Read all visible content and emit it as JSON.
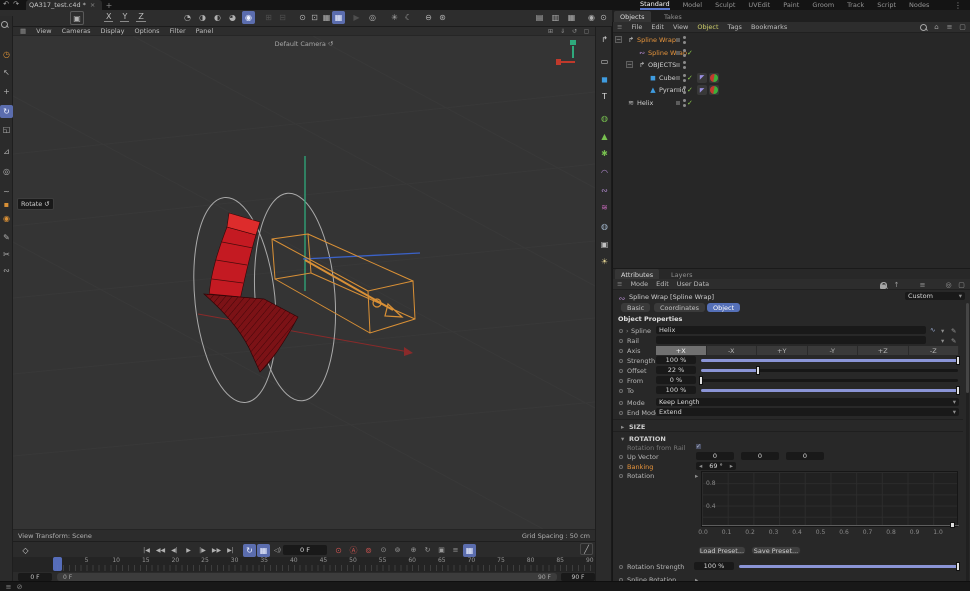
{
  "ui": {
    "drop": "▾",
    "check": "✓",
    "minus": "−",
    "plus": "+"
  },
  "window": {
    "undo_glyph": "↶",
    "redo_glyph": "↷",
    "doc_tab": "QA317_test.c4d *",
    "close_glyph": "×",
    "new_tab_glyph": "+"
  },
  "layout_tabs": {
    "items": [
      "Standard",
      "Model",
      "Sculpt",
      "UVEdit",
      "Paint",
      "Groom",
      "Track",
      "Script",
      "Nodes"
    ],
    "active": "Standard",
    "overflow_glyph": "⋮"
  },
  "toolbar": {
    "axis_locks": [
      "X",
      "Y",
      "Z"
    ],
    "box_tool_glyph": "▣",
    "icons": [
      {
        "name": "render-view",
        "glyph": "◔"
      },
      {
        "name": "render-region",
        "glyph": "◑"
      },
      {
        "name": "render-material",
        "glyph": "◐"
      },
      {
        "name": "render-picture-viewer",
        "glyph": "◕"
      },
      {
        "name": "render-settings",
        "glyph": "◉",
        "mod": "blue"
      },
      {
        "name": "disabled-tool-a",
        "glyph": "⊞",
        "mod": "dim"
      },
      {
        "name": "disabled-tool-b",
        "glyph": "⊟",
        "mod": "dim"
      },
      {
        "name": "object-axis",
        "glyph": "⊙"
      },
      {
        "name": "workplane",
        "glyph": "⊡"
      },
      {
        "name": "snap-grid",
        "glyph": "▦"
      },
      {
        "name": "quantize",
        "glyph": "▦",
        "mod": "blue"
      },
      {
        "name": "play-disabled",
        "glyph": "▶",
        "mod": "dim"
      },
      {
        "name": "target",
        "glyph": "◎"
      },
      {
        "name": "simulate",
        "glyph": "✳"
      },
      {
        "name": "field-moon",
        "glyph": "☾"
      },
      {
        "name": "remove-circle",
        "glyph": "⊖"
      },
      {
        "name": "modify-circle",
        "glyph": "⊛"
      },
      {
        "name": "layout-panel-a",
        "glyph": "▤"
      },
      {
        "name": "layout-panel-b",
        "glyph": "▥"
      },
      {
        "name": "layout-panel-c",
        "glyph": "▦"
      },
      {
        "name": "user-sphere",
        "glyph": "◉"
      },
      {
        "name": "user-dot",
        "glyph": "⊙"
      }
    ]
  },
  "left_palette": {
    "icons": [
      {
        "name": "search",
        "glyph": "mag"
      },
      {
        "name": "live-selection",
        "glyph": "◷",
        "color": "#d99036"
      },
      {
        "name": "selection-cursor",
        "glyph": "↖"
      },
      {
        "name": "move-tool",
        "glyph": "+"
      },
      {
        "name": "rotate-tool",
        "glyph": "↻",
        "active": true
      },
      {
        "name": "scale-tool",
        "glyph": "◱"
      },
      {
        "name": "axis-tool",
        "glyph": "⊿"
      },
      {
        "name": "coord-tool",
        "glyph": "◎"
      },
      {
        "name": "curve-tool",
        "glyph": "~"
      },
      {
        "name": "point-tool",
        "glyph": "▪",
        "color": "#d99036"
      },
      {
        "name": "clone-tool",
        "glyph": "◉",
        "color": "#d99036"
      },
      {
        "name": "pen-tool",
        "glyph": "✎"
      },
      {
        "name": "knife-tool",
        "glyph": "✂"
      },
      {
        "name": "spline-tool",
        "glyph": "∾"
      }
    ]
  },
  "right_palette": {
    "icons": [
      {
        "name": "spline-wrap-command",
        "glyph": "↱",
        "color": "#d0d0d0"
      },
      {
        "name": "rectangle-spline",
        "glyph": "▭",
        "color": "#d8d8d8"
      },
      {
        "name": "cube-primitive",
        "glyph": "◼",
        "color": "#3f9ce0"
      },
      {
        "name": "text-object",
        "glyph": "T",
        "color": "#d8d8d8"
      },
      {
        "name": "generator-subdivide",
        "glyph": "◍",
        "color": "#77c04f"
      },
      {
        "name": "generator-array",
        "glyph": "▲",
        "color": "#77c04f"
      },
      {
        "name": "generator-boole",
        "glyph": "✱",
        "color": "#77c04f"
      },
      {
        "name": "deformer-bend",
        "glyph": "◠",
        "color": "#b78fd6"
      },
      {
        "name": "deformer-spline-wrap",
        "glyph": "∾",
        "color": "#b78fd6"
      },
      {
        "name": "deformer-other",
        "glyph": "≋",
        "color": "#c468b8"
      },
      {
        "name": "environment",
        "glyph": "◍",
        "color": "#9fb3c8"
      },
      {
        "name": "camera",
        "glyph": "▣",
        "color": "#c0c0c0"
      },
      {
        "name": "light",
        "glyph": "☀",
        "color": "#e0d090"
      }
    ]
  },
  "viewport": {
    "menu_icon": "▦",
    "menu": [
      "View",
      "Cameras",
      "Display",
      "Options",
      "Filter",
      "Panel"
    ],
    "header_icons": [
      {
        "name": "grid-dots",
        "glyph": "⊞"
      },
      {
        "name": "pin-down",
        "glyph": "⇓"
      },
      {
        "name": "sync-rotate",
        "glyph": "↺"
      },
      {
        "name": "float-view",
        "glyph": "▢"
      }
    ],
    "camera_label": "Default Camera",
    "camera_icon": "↺",
    "tooltip_label": "Rotate",
    "tooltip_icon": "↺",
    "view_transform": "View Transform: Scene",
    "grid_spacing": "Grid Spacing : 50 cm"
  },
  "object_manager": {
    "tabs": [
      "Objects",
      "Takes"
    ],
    "active_tab": "Objects",
    "menu_icon": "≡",
    "menu": [
      "File",
      "Edit",
      "View",
      "Object",
      "Tags",
      "Bookmarks"
    ],
    "highlight_menu": "Object",
    "header_icons": [
      {
        "name": "search",
        "glyph": "mag"
      },
      {
        "name": "home",
        "glyph": "⌂"
      },
      {
        "name": "filter",
        "glyph": "≡"
      },
      {
        "name": "panel-popout",
        "glyph": "▢"
      }
    ],
    "expand_glyph": "−",
    "check_glyph": "✓",
    "tree": [
      {
        "name": "Spline Wrap",
        "level": 0,
        "selected": true,
        "icon": "null",
        "expand": true,
        "check": false,
        "tags": []
      },
      {
        "name": "Spline Wrap",
        "level": 1,
        "selected": true,
        "icon": "splinewrap",
        "expand": false,
        "check": true,
        "tags": []
      },
      {
        "name": "OBJECTS",
        "level": 1,
        "selected": false,
        "icon": "null",
        "expand": true,
        "check": false,
        "tags": []
      },
      {
        "name": "Cube",
        "level": 2,
        "selected": false,
        "icon": "cube",
        "expand": false,
        "check": true,
        "tags": [
          "phong",
          "material"
        ]
      },
      {
        "name": "Pyramid",
        "level": 2,
        "selected": false,
        "icon": "pyramid",
        "expand": false,
        "check": true,
        "tags": [
          "phong",
          "material"
        ]
      },
      {
        "name": "Helix",
        "level": 0,
        "selected": false,
        "icon": "helix",
        "expand": false,
        "check": true,
        "tags": []
      }
    ]
  },
  "attributes": {
    "tabs": [
      "Attributes",
      "Layers"
    ],
    "active_tab": "Attributes",
    "menu_icon": "≡",
    "menu": [
      "Mode",
      "Edit",
      "User Data"
    ],
    "header_icons": [
      {
        "name": "back",
        "glyph": "←"
      },
      {
        "name": "up",
        "glyph": "↑"
      },
      {
        "name": "search",
        "glyph": "mag"
      },
      {
        "name": "filter",
        "glyph": "≡"
      },
      {
        "name": "lock",
        "glyph": "lock"
      },
      {
        "name": "focus",
        "glyph": "◎"
      },
      {
        "name": "popout",
        "glyph": "▢"
      }
    ],
    "title_icon": "∾",
    "title": "Spline Wrap [Spline Wrap]",
    "preset_dropdown": "Custom",
    "mode_tabs": [
      "Basic",
      "Coordinates",
      "Object"
    ],
    "active_mode_tab": "Object",
    "section": "Object Properties",
    "rows": {
      "spline": {
        "label": "Spline",
        "expander": "›",
        "value": "Helix",
        "icon_spline": "∿",
        "icon_pick": "✎"
      },
      "rail": {
        "label": "Rail",
        "value": "",
        "icon_pick": "✎"
      },
      "axis": {
        "label": "Axis",
        "options": [
          "+X",
          "-X",
          "+Y",
          "-Y",
          "+Z",
          "-Z"
        ],
        "active": "+X"
      },
      "strength": {
        "label": "Strength",
        "value": "100 %",
        "percent": 100
      },
      "offset": {
        "label": "Offset",
        "value": "22 %",
        "percent": 22
      },
      "from": {
        "label": "From",
        "value": "0 %",
        "percent": 0
      },
      "to": {
        "label": "To",
        "value": "100 %",
        "percent": 100
      },
      "mode": {
        "label": "Mode",
        "value": "Keep Length"
      },
      "end_mode": {
        "label": "End Mode",
        "value": "Extend"
      }
    },
    "size_section": "SIZE",
    "size_expander": "▸",
    "rotation_section": "ROTATION",
    "rotation_expander": "▾",
    "rotation_rows": {
      "rotation_from_rail": {
        "label": "Rotation from Rail",
        "checked": true
      },
      "up_vector": {
        "label": "Up Vector",
        "values": [
          "0",
          "0",
          "0"
        ]
      },
      "banking": {
        "label": "Banking",
        "dec": "◂",
        "value": "69 °",
        "inc": "▸"
      },
      "rotation": {
        "label": "Rotation",
        "expander": "▸"
      }
    },
    "graph": {
      "y_labels": [
        "0.8",
        "0.4"
      ],
      "x_labels": [
        "0.0",
        "0.1",
        "0.2",
        "0.3",
        "0.4",
        "0.5",
        "0.6",
        "0.7",
        "0.8",
        "0.9",
        "1.0"
      ]
    },
    "buttons": {
      "load": "Load Preset...",
      "save": "Save Preset..."
    },
    "rotation_strength": {
      "label": "Rotation Strength",
      "value": "100 %",
      "percent": 100
    },
    "spline_rotation": {
      "label": "Spline Rotation",
      "expander": "▸"
    }
  },
  "timeline": {
    "key_glyph": "◇",
    "transport": [
      {
        "name": "goto-start",
        "glyph": "|◀"
      },
      {
        "name": "prev-key",
        "glyph": "◀◀"
      },
      {
        "name": "prev-frame",
        "glyph": "◀|"
      },
      {
        "name": "play-forward",
        "glyph": "▶"
      },
      {
        "name": "next-frame",
        "glyph": "|▶"
      },
      {
        "name": "next-key",
        "glyph": "▶▶"
      },
      {
        "name": "goto-end",
        "glyph": "▶|"
      },
      {
        "name": "playback-loop",
        "glyph": "↻",
        "mod": "blue"
      },
      {
        "name": "playback-mode",
        "glyph": "▦",
        "mod": "blue"
      },
      {
        "name": "sound",
        "glyph": "◁)"
      },
      {
        "name": "record-keyframe",
        "glyph": "⊙",
        "mod": "red"
      },
      {
        "name": "autokeying",
        "glyph": "Ⓐ",
        "mod": "red"
      },
      {
        "name": "record-selected",
        "glyph": "⊚",
        "mod": "red"
      },
      {
        "name": "key-position",
        "glyph": "⊙",
        "mod": "gray"
      },
      {
        "name": "key-scale",
        "glyph": "⊚",
        "mod": "gray"
      },
      {
        "name": "key-rotation",
        "glyph": "⊕",
        "mod": "gray"
      },
      {
        "name": "key-parameter",
        "glyph": "↻",
        "mod": "gray"
      },
      {
        "name": "key-pla",
        "glyph": "▣",
        "mod": "gray"
      },
      {
        "name": "timeline-layers",
        "glyph": "≡",
        "mod": "gray"
      },
      {
        "name": "autokey-region",
        "glyph": "▦",
        "mod": "blue"
      }
    ],
    "frame_field": "0 F",
    "ticks": [
      "5",
      "10",
      "15",
      "20",
      "25",
      "30",
      "35",
      "40",
      "45",
      "50",
      "55",
      "60",
      "65",
      "70",
      "75",
      "80",
      "85",
      "90"
    ],
    "range_start_field": "0 F",
    "range_bar_start": "0 F",
    "range_bar_end": "90 F",
    "range_end_field": "90 F",
    "curve_icon": "╱"
  },
  "statusbar": {
    "icons": [
      {
        "name": "status-menu",
        "glyph": "≡"
      },
      {
        "name": "status-ok",
        "glyph": "⊘"
      }
    ]
  },
  "colors": {
    "accent_blue": "#5b6dae",
    "selection_orange": "#e8953c",
    "check_green": "#8fce4e",
    "record_red": "#c0504d",
    "axis_x_red": "#8a2a2a",
    "axis_y_green": "#2fa97c",
    "axis_z_blue": "#3b62c8",
    "wire_orange": "#d99036",
    "object_red": "#c41a22"
  }
}
